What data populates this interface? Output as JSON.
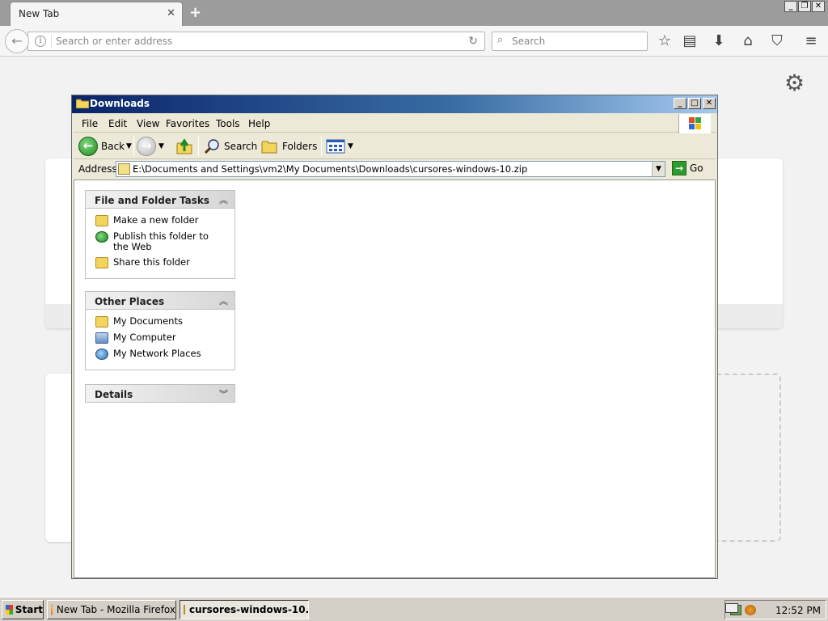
{
  "firefox": {
    "tab_title": "New Tab",
    "url_placeholder": "Search or enter address",
    "search_placeholder": "Search"
  },
  "explorer": {
    "title": "Downloads",
    "menus": [
      "File",
      "Edit",
      "View",
      "Favorites",
      "Tools",
      "Help"
    ],
    "toolbar": {
      "back": "Back",
      "search": "Search",
      "folders": "Folders"
    },
    "address_label": "Address",
    "address_value": "E:\\Documents and Settings\\vm2\\My Documents\\Downloads\\cursores-windows-10.zip",
    "go_label": "Go",
    "panels": {
      "file_tasks": {
        "title": "File and Folder Tasks",
        "items": [
          "Make a new folder",
          "Publish this folder to the Web",
          "Share this folder"
        ]
      },
      "other_places": {
        "title": "Other Places",
        "items": [
          "My Documents",
          "My Computer",
          "My Network Places"
        ]
      },
      "details": {
        "title": "Details"
      }
    }
  },
  "taskbar": {
    "start": "Start",
    "items": [
      "New Tab - Mozilla Firefox",
      "cursores-windows-10..."
    ],
    "clock": "12:52 PM"
  }
}
